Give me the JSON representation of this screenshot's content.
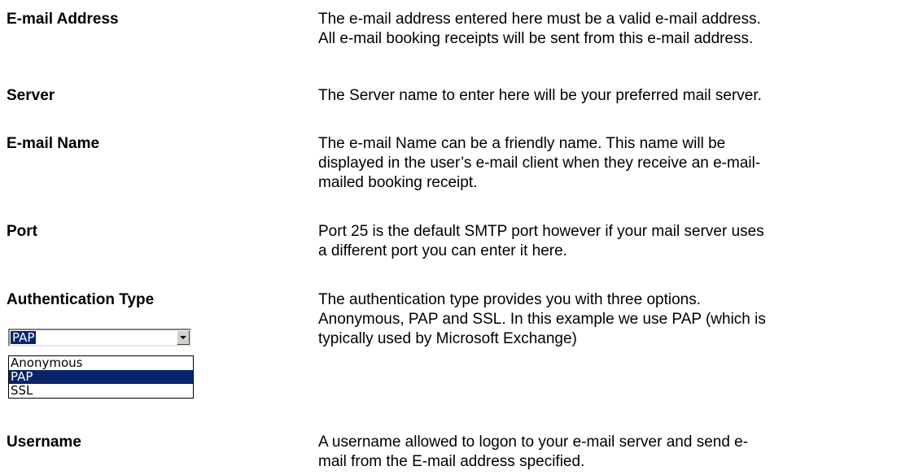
{
  "rows": [
    {
      "term": "E-mail Address",
      "lines": [
        "The e-mail address entered here must be a valid e-mail address.",
        "All e-mail booking receipts will be sent from this e-mail address."
      ]
    },
    {
      "term": "Server",
      "lines": [
        "The Server name to enter here will be your preferred mail server."
      ]
    },
    {
      "term": "E-mail Name",
      "lines": [
        "The e-mail Name can be a friendly name. This name will be",
        "displayed in the user’s e-mail client when they receive an e-mail-",
        "mailed booking receipt."
      ]
    },
    {
      "term": "Port",
      "lines": [
        "Port 25 is the default SMTP port however if your mail server uses",
        "a different port you can enter it here."
      ]
    },
    {
      "term": "Authentication Type",
      "lines": [
        "The authentication type provides you with three options.",
        "Anonymous, PAP and SSL. In this example we use PAP (which is",
        "typically used by Microsoft Exchange)"
      ]
    },
    {
      "term": "Username",
      "lines": [
        "A username allowed to logon to your e-mail server and send e-",
        "mail from the E-mail address specified."
      ]
    }
  ],
  "auth_dropdown": {
    "selected": "PAP",
    "options": [
      "Anonymous",
      "PAP",
      "SSL"
    ],
    "arrow_icon": "chevron-down-icon",
    "highlight_color": "#0a246a"
  }
}
